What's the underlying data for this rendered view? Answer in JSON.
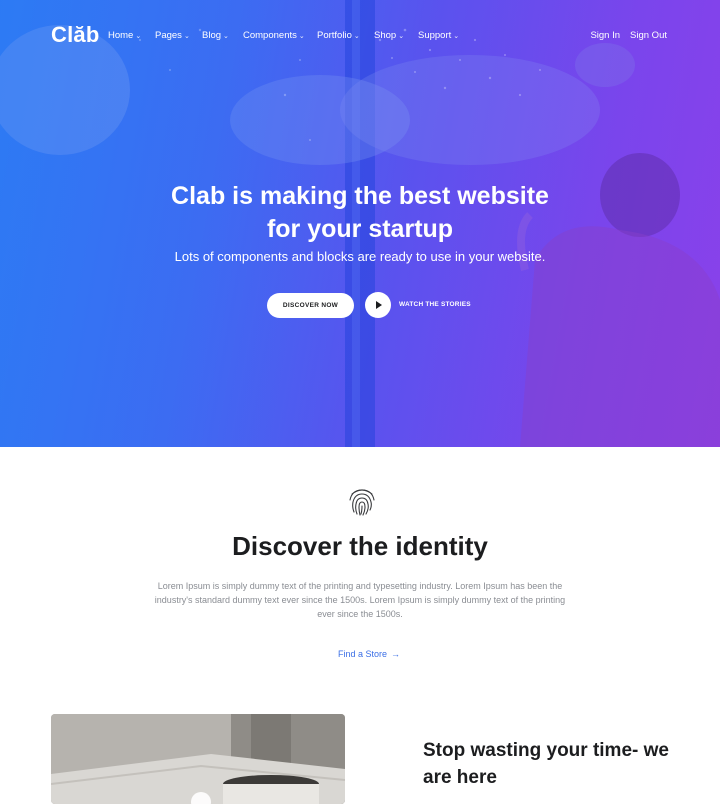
{
  "brand": {
    "logo": "Clăb"
  },
  "nav": {
    "items": [
      {
        "label": "Home"
      },
      {
        "label": "Pages"
      },
      {
        "label": "Blog"
      },
      {
        "label": "Components"
      },
      {
        "label": "Portfolio"
      },
      {
        "label": "Shop"
      },
      {
        "label": "Support"
      }
    ],
    "sign_in": "Sign In",
    "sign_out": "Sign Out"
  },
  "hero": {
    "title_line1": "Clab is making the best website",
    "title_line2": "for your startup",
    "subtitle": "Lots of components and blocks are ready to use in your website.",
    "discover_label": "DISCOVER NOW",
    "watch_label": "WATCH THE STORIES"
  },
  "identity": {
    "icon": "fingerprint-icon",
    "title": "Discover the identity",
    "text": "Lorem Ipsum is simply dummy text of the printing and typesetting industry. Lorem Ipsum has been the industry's standard dummy text ever since the 1500s. Lorem Ipsum is simply dummy text of the printing ever since the 1500s.",
    "link_label": "Find a Store",
    "link_arrow": "→"
  },
  "feature": {
    "title": "Stop wasting your time- we are here"
  },
  "colors": {
    "accent": "#3b6fe6",
    "gradient_start": "#2f7cf3",
    "gradient_end": "#8a42ea"
  }
}
